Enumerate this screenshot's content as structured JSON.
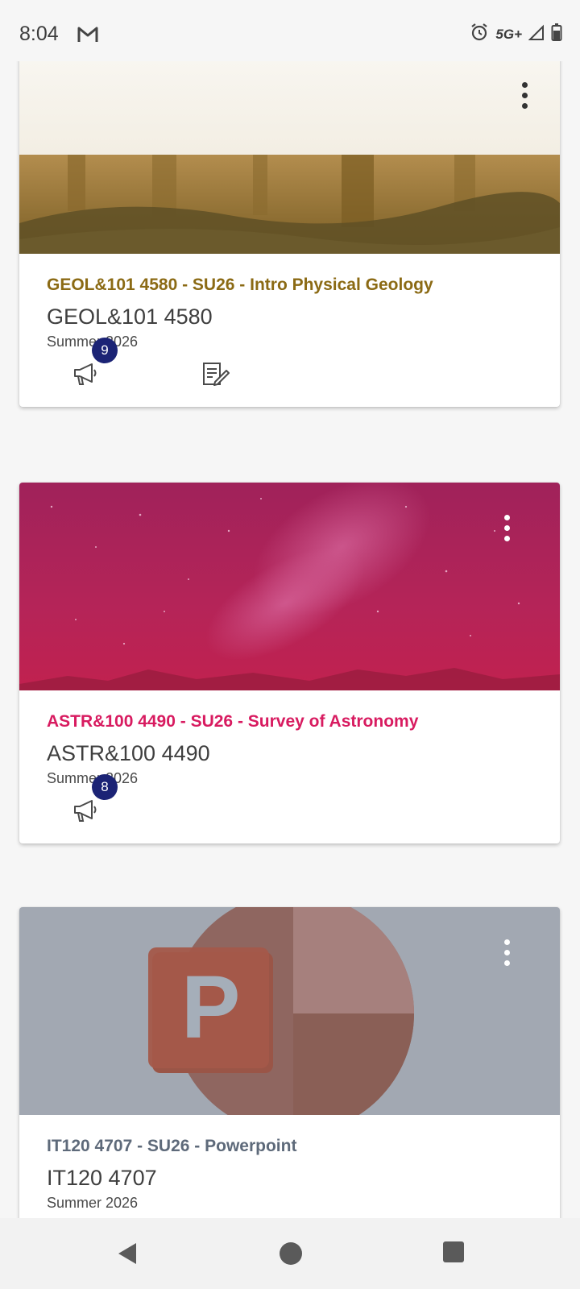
{
  "status_bar": {
    "time": "8:04",
    "network": "5G+",
    "icons": [
      "gmail-icon",
      "alarm-icon",
      "signal-icon",
      "battery-icon"
    ]
  },
  "courses": [
    {
      "title": "GEOL&101 4580 - SU26 - Intro Physical Geology",
      "code": "GEOL&101 4580",
      "term": "Summer 2026",
      "title_color": "#8b6a14",
      "announcement_badge": "9",
      "actions": [
        "announcements-icon",
        "assignments-icon"
      ]
    },
    {
      "title": "ASTR&100 4490 - SU26 - Survey of Astronomy",
      "code": "ASTR&100 4490",
      "term": "Summer 2026",
      "title_color": "#d81b60",
      "announcement_badge": "8",
      "actions": [
        "announcements-icon"
      ]
    },
    {
      "title": "IT120 4707 - SU26 - Powerpoint",
      "code": "IT120 4707",
      "term": "Summer 2026",
      "title_color": "#5e6a7a",
      "actions": []
    }
  ],
  "powerpoint_logo_letter": "P",
  "nav": [
    "back-icon",
    "home-icon",
    "recents-icon"
  ]
}
